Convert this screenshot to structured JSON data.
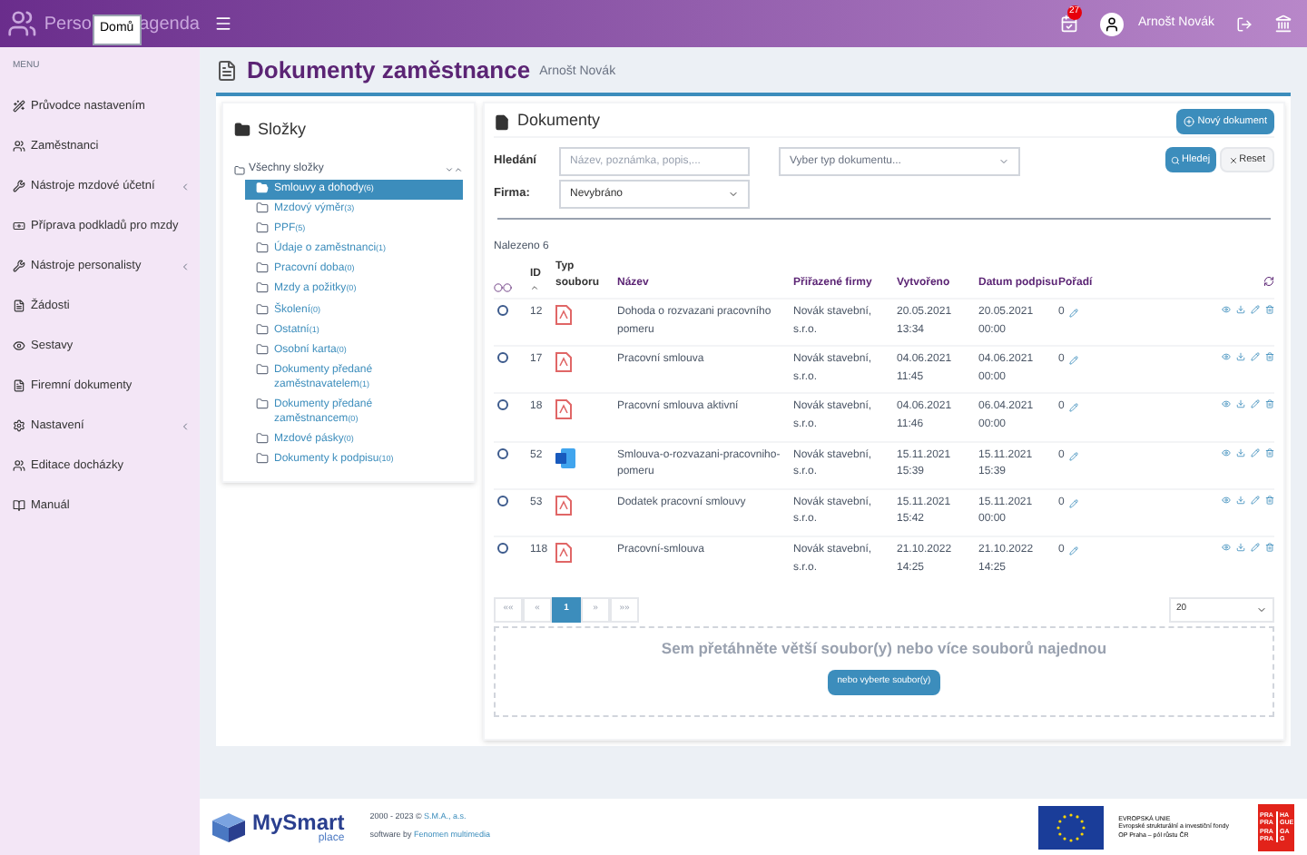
{
  "header": {
    "brand_start": "Perso",
    "brand_end": "agenda",
    "tooltip": "Domů",
    "notification_count": "27",
    "user_name": "Arnošt Novák"
  },
  "sidebar": {
    "heading": "MENU",
    "items": [
      {
        "label": "Průvodce nastavením",
        "expandable": false
      },
      {
        "label": "Zaměstnanci",
        "expandable": false
      },
      {
        "label": "Nástroje mzdové účetní",
        "expandable": true
      },
      {
        "label": "Příprava podkladů pro mzdy",
        "expandable": false
      },
      {
        "label": "Nástroje personalisty",
        "expandable": true
      },
      {
        "label": "Žádosti",
        "expandable": false
      },
      {
        "label": "Sestavy",
        "expandable": false
      },
      {
        "label": "Firemní dokumenty",
        "expandable": false
      },
      {
        "label": "Nastavení",
        "expandable": true
      },
      {
        "label": "Editace docházky",
        "expandable": false
      },
      {
        "label": "Manuál",
        "expandable": false
      }
    ]
  },
  "page": {
    "title": "Dokumenty zaměstnance",
    "subtitle": "Arnošt Novák"
  },
  "folders": {
    "title": "Složky",
    "root": {
      "label": "Všechny složky",
      "children": [
        {
          "label": "Smlouvy a dohody",
          "count": "(6)",
          "selected": true
        },
        {
          "label": "Mzdový výměr",
          "count": "(3)",
          "selected": false
        },
        {
          "label": "PPF",
          "count": "(5)",
          "selected": false
        },
        {
          "label": "Údaje o zaměstnanci",
          "count": "(1)",
          "selected": false
        },
        {
          "label": "Pracovní doba",
          "count": "(0)",
          "selected": false
        },
        {
          "label": "Mzdy a požitky",
          "count": "(0)",
          "selected": false
        },
        {
          "label": "Školení",
          "count": "(0)",
          "selected": false
        },
        {
          "label": "Ostatní",
          "count": "(1)",
          "selected": false
        },
        {
          "label": "Osobní karta",
          "count": "(0)",
          "selected": false
        },
        {
          "label": "Dokumenty předané zaměstnavatelem",
          "count": "(1)",
          "selected": false
        },
        {
          "label": "Dokumenty předané zaměstnancem",
          "count": "(0)",
          "selected": false
        },
        {
          "label": "Mzdové pásky",
          "count": "(0)",
          "selected": false
        },
        {
          "label": "Dokumenty k podpisu",
          "count": "(10)",
          "selected": false
        }
      ]
    }
  },
  "documents": {
    "title": "Dokumenty",
    "new_button": "Nový dokument",
    "search_label": "Hledání",
    "search_placeholder": "Název, poznámka, popis,...",
    "type_placeholder": "Vyber typ dokumentu...",
    "company_label": "Firma:",
    "company_value": "Nevybráno",
    "search_button": "Hledej",
    "reset_button": "Reset",
    "found": "Nalezeno 6",
    "columns": [
      "ID",
      "Typ souboru",
      "Název",
      "Přiřazené firmy",
      "Vytvořeno",
      "Datum podpisu",
      "Pořadí"
    ],
    "rows": [
      {
        "selected": false,
        "id": "12",
        "kind": "pdf",
        "name": "Dohoda o rozvazani pracovního pomeru",
        "company": "Novák stavební, s.r.o.",
        "created": "20.05.2021 13:34",
        "signed": "20.05.2021 00:00",
        "order": "0"
      },
      {
        "selected": false,
        "id": "17",
        "kind": "pdf",
        "name": "Pracovní smlouva",
        "company": "Novák stavební, s.r.o.",
        "created": "04.06.2021 11:45",
        "signed": "04.06.2021 00:00",
        "order": "0"
      },
      {
        "selected": false,
        "id": "18",
        "kind": "pdf",
        "name": "Pracovní smlouva aktivní",
        "company": "Novák stavební, s.r.o.",
        "created": "04.06.2021 11:46",
        "signed": "06.04.2021 00:00",
        "order": "0"
      },
      {
        "selected": false,
        "id": "52",
        "kind": "word",
        "name": "Smlouva-o-rozvazani-pracovniho-pomeru",
        "company": "Novák stavební, s.r.o.",
        "created": "15.11.2021 15:39",
        "signed": "15.11.2021 15:39",
        "order": "0"
      },
      {
        "selected": false,
        "id": "53",
        "kind": "pdf",
        "name": "Dodatek pracovní smlouvy",
        "company": "Novák stavební, s.r.o.",
        "created": "15.11.2021 15:42",
        "signed": "15.11.2021 00:00",
        "order": "0"
      },
      {
        "selected": false,
        "id": "118",
        "kind": "pdf",
        "name": "Pracovní-smlouva",
        "company": "Novák stavební, s.r.o.",
        "created": "21.10.2022 14:25",
        "signed": "21.10.2022 14:25",
        "order": "0"
      }
    ],
    "pagination": [
      {
        "label": "««",
        "selected": false
      },
      {
        "label": "«",
        "selected": false
      },
      {
        "label": "1",
        "selected": true
      },
      {
        "label": "»",
        "selected": false
      },
      {
        "label": "»»",
        "selected": false
      }
    ],
    "page_size": "20",
    "dropzone_text": "Sem přetáhněte větší soubor(y) nebo více souborů najednou",
    "dropzone_button": "nebo vyberte soubor(y)"
  },
  "footer": {
    "logo_main": "MySmart",
    "logo_sub": "place",
    "copyright_prefix": "2000 - 2023 © ",
    "copyright_link": "S.M.A., a.s.",
    "software_prefix": "software by ",
    "software_link": "Fenomen multimedia",
    "eu_lines": [
      "EVROPSKÁ UNIE",
      "Evropské strukturální a investiční fondy",
      "OP Praha – pól růstu ČR"
    ],
    "praha_logo": [
      "PRA",
      "HA",
      "PRA",
      "GUE",
      "PRA",
      "GA",
      "PRA",
      "G"
    ]
  }
}
